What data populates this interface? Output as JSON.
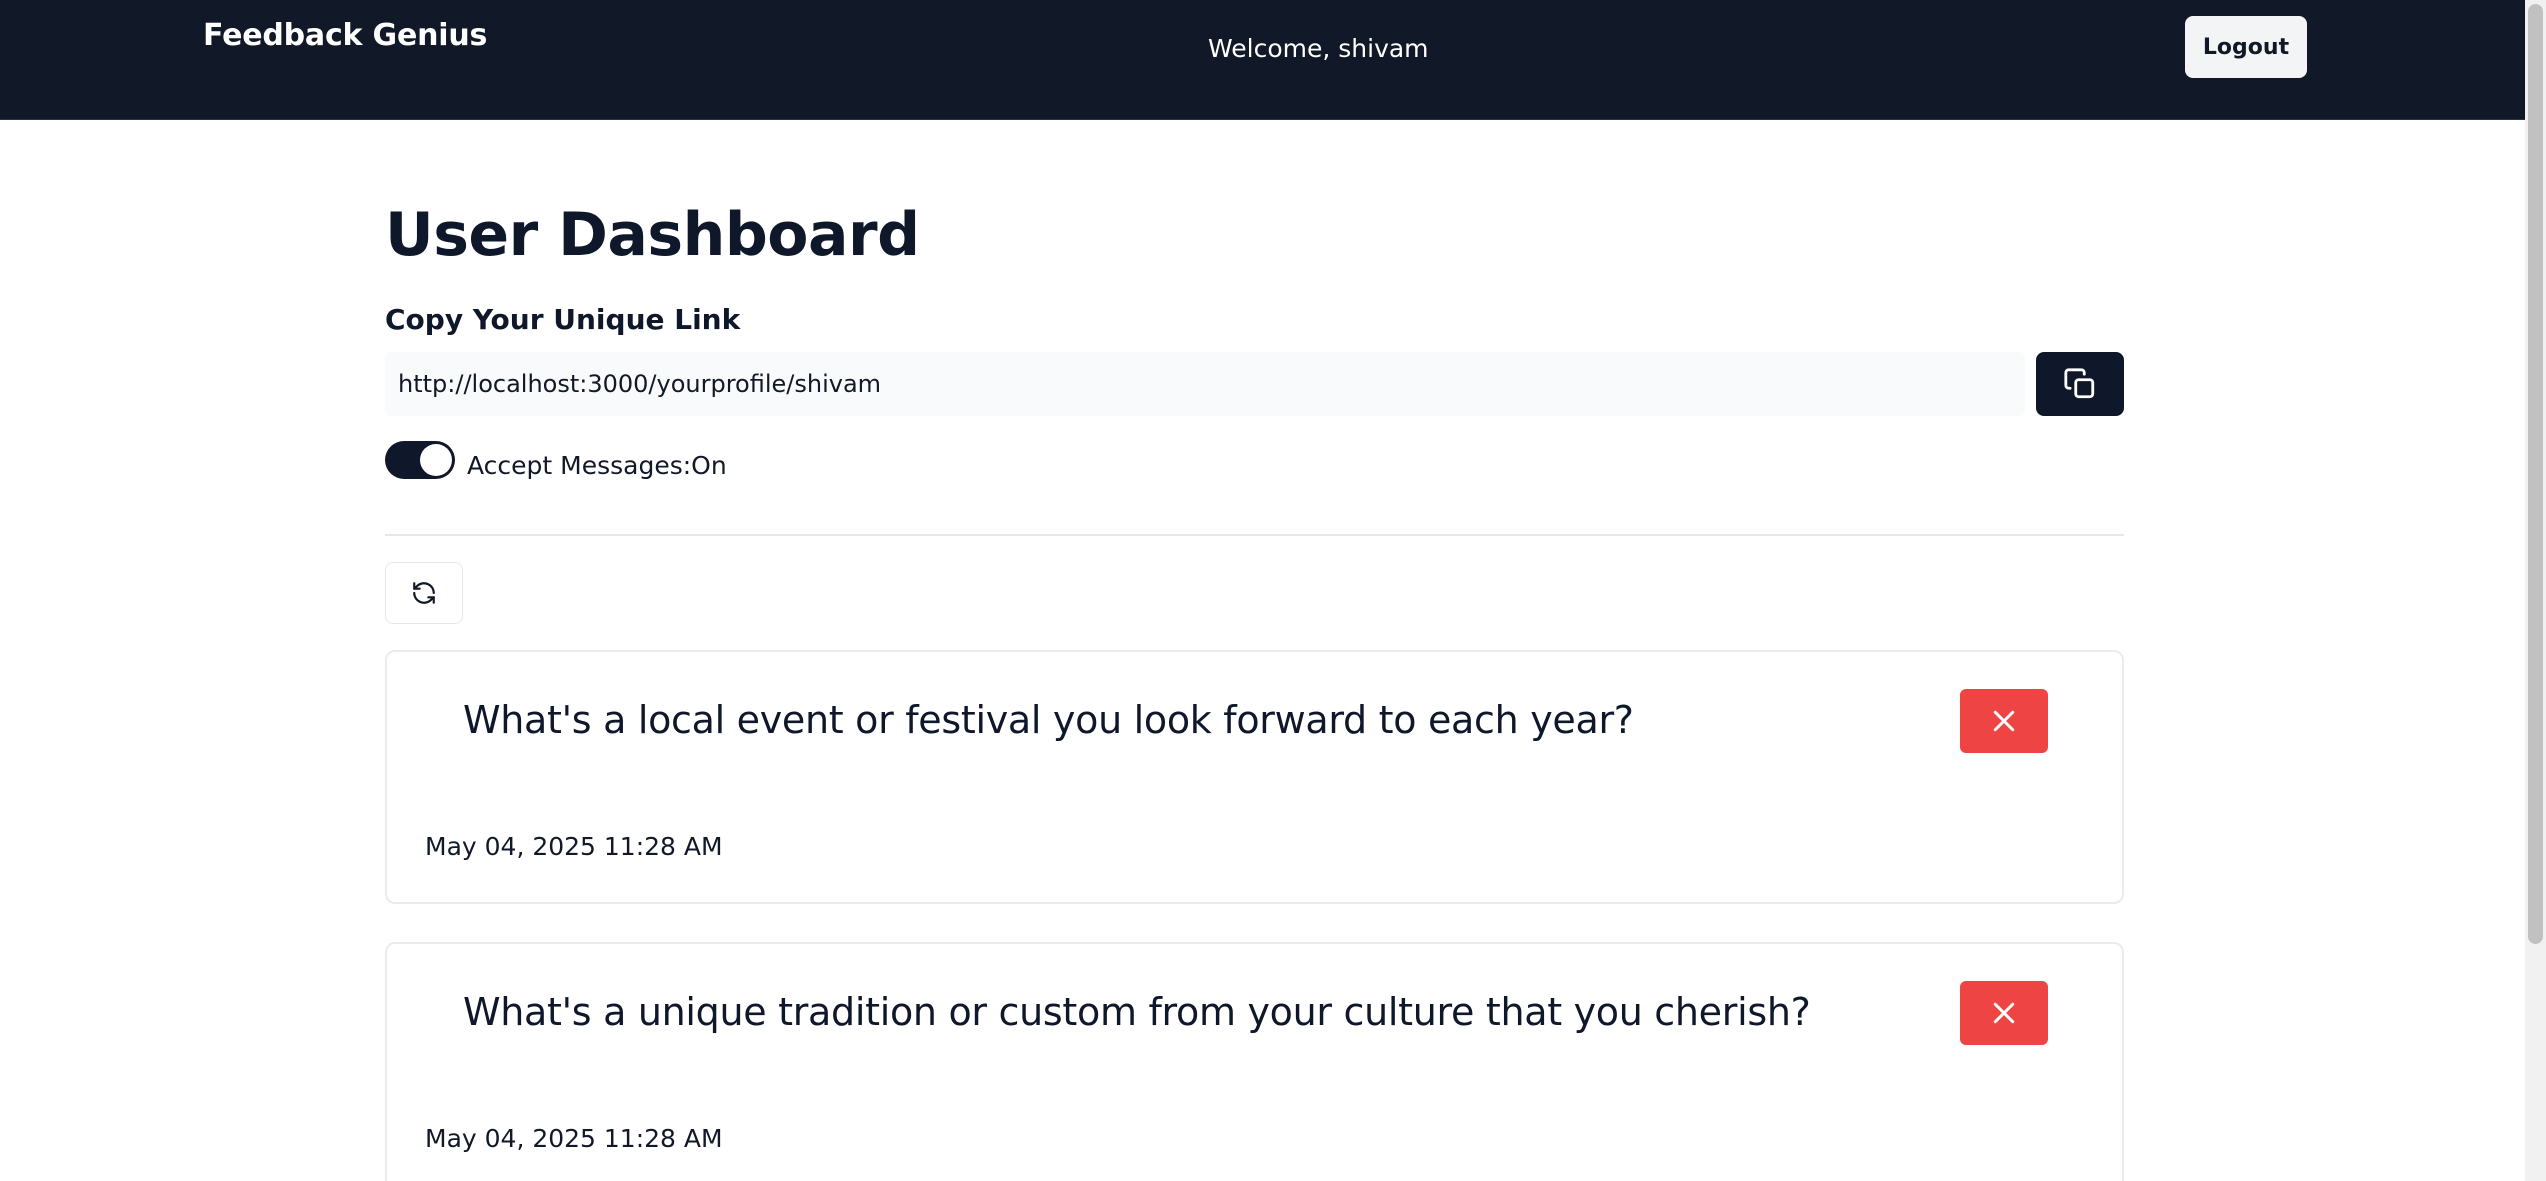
{
  "navbar": {
    "brand": "Feedback Genius",
    "welcome": "Welcome, shivam",
    "logout_label": "Logout"
  },
  "dashboard": {
    "title": "User Dashboard",
    "link_heading": "Copy Your Unique Link",
    "link_value": "http://localhost:3000/yourprofile/shivam",
    "accept_messages_label": "Accept Messages:On",
    "accept_messages_on": true
  },
  "messages": [
    {
      "content": "What's a local event or festival you look forward to each year?",
      "date": "May 04, 2025 11:28 AM"
    },
    {
      "content": "What's a unique tradition or custom from your culture that you cherish?",
      "date": "May 04, 2025 11:28 AM"
    }
  ],
  "icons": {
    "copy": "copy-icon",
    "refresh": "refresh-icon",
    "delete": "x-icon"
  },
  "colors": {
    "navbar_bg": "#111827",
    "primary": "#0f172a",
    "danger": "#ef4444"
  }
}
